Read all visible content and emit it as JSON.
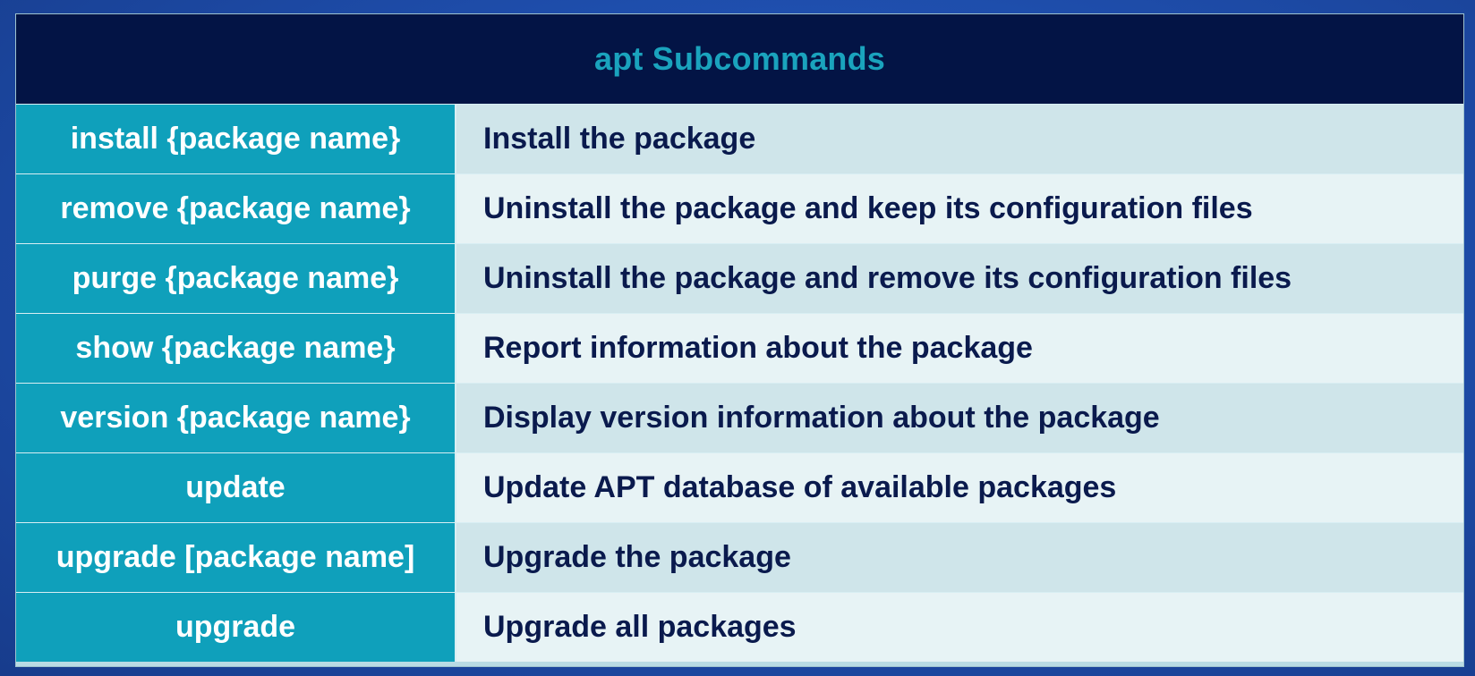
{
  "table": {
    "title": "apt Subcommands",
    "rows": [
      {
        "command": "install {package name}",
        "description": "Install the package"
      },
      {
        "command": "remove {package name}",
        "description": "Uninstall the package and keep its configuration files"
      },
      {
        "command": "purge {package name}",
        "description": "Uninstall the package and remove its configuration files"
      },
      {
        "command": "show {package name}",
        "description": "Report information about the package"
      },
      {
        "command": "version {package name}",
        "description": "Display version information about the package"
      },
      {
        "command": "update",
        "description": "Update APT database of available packages"
      },
      {
        "command": "upgrade [package name]",
        "description": "Upgrade the package"
      },
      {
        "command": "upgrade",
        "description": "Upgrade all packages"
      }
    ]
  },
  "colors": {
    "header_bg": "#031445",
    "header_text": "#1aa3bd",
    "command_bg": "#0fa0bb",
    "description_text": "#0a1a4d",
    "row_odd_bg": "#cfe5ea",
    "row_even_bg": "#e7f3f5"
  }
}
